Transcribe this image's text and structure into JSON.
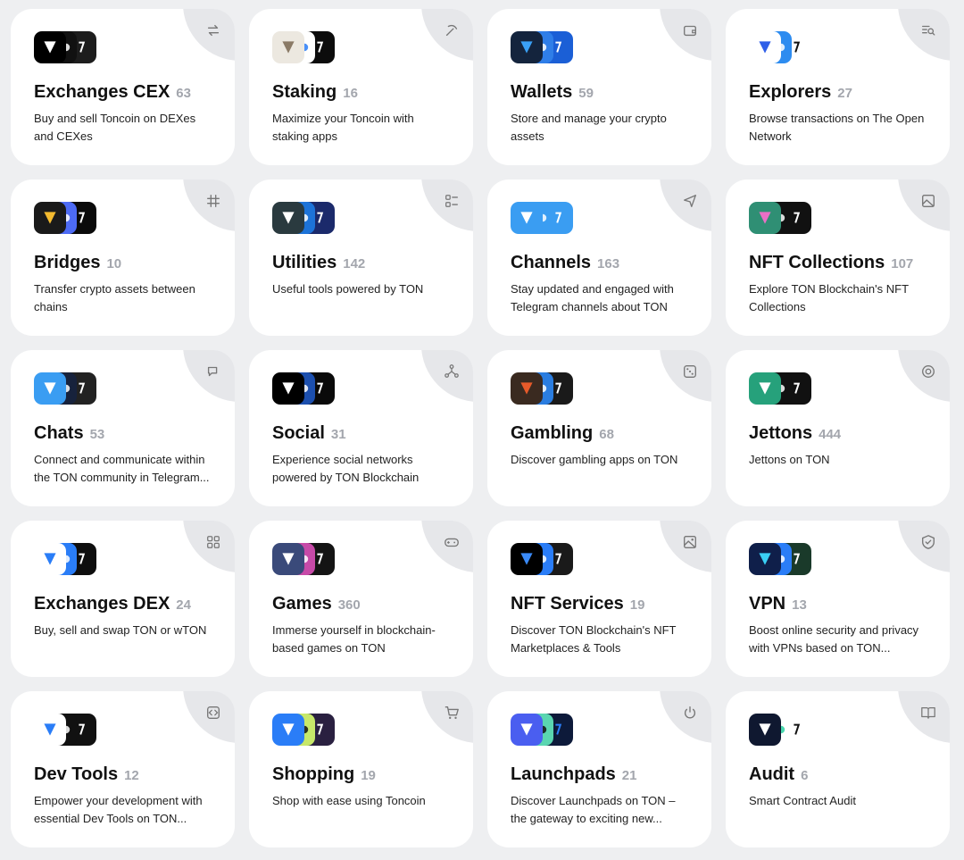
{
  "categories": [
    {
      "title": "Exchanges CEX",
      "count": "63",
      "description": "Buy and sell Toncoin on DEXes and CEXes",
      "icon": "exchange-arrows-icon",
      "app_icons": [
        {
          "bg": "#000000",
          "fg": "#ffffff"
        },
        {
          "bg": "#111111",
          "fg": "#ffffff"
        },
        {
          "bg": "#1d1d1d",
          "fg": "#ffffff"
        }
      ]
    },
    {
      "title": "Staking",
      "count": "16",
      "description": "Maximize your Toncoin with staking apps",
      "icon": "pickaxe-icon",
      "app_icons": [
        {
          "bg": "#ece8e0",
          "fg": "#8a7a66"
        },
        {
          "bg": "#ffffff",
          "fg": "#2a7df7"
        },
        {
          "bg": "#0c0c0c",
          "fg": "#ffffff"
        }
      ]
    },
    {
      "title": "Wallets",
      "count": "59",
      "description": "Store and manage your crypto assets",
      "icon": "wallet-icon",
      "app_icons": [
        {
          "bg": "#14243d",
          "fg": "#3aa0f6"
        },
        {
          "bg": "#2f7ee8",
          "fg": "#ffffff"
        },
        {
          "bg": "#1b5fd6",
          "fg": "#ffffff"
        }
      ]
    },
    {
      "title": "Explorers",
      "count": "27",
      "description": "Browse transactions on The Open Network",
      "icon": "search-list-icon",
      "app_icons": [
        {
          "bg": "#ffffff",
          "fg": "#2f5fe8"
        },
        {
          "bg": "#2d8cf0",
          "fg": "#ffffff"
        },
        {
          "bg": "#ffffff",
          "fg": "#111111"
        }
      ]
    },
    {
      "title": "Bridges",
      "count": "10",
      "description": "Transfer crypto assets between chains",
      "icon": "bridge-icon",
      "app_icons": [
        {
          "bg": "#1a1a1a",
          "fg": "#f3ba2f"
        },
        {
          "bg": "#4d6bf5",
          "fg": "#ffffff"
        },
        {
          "bg": "#0a0a0a",
          "fg": "#ffffff"
        }
      ]
    },
    {
      "title": "Utilities",
      "count": "142",
      "description": "Useful tools powered by TON",
      "icon": "list-icon",
      "app_icons": [
        {
          "bg": "#2a3a3f",
          "fg": "#ffffff"
        },
        {
          "bg": "#1d73d8",
          "fg": "#ffffff"
        },
        {
          "bg": "#1b2a6b",
          "fg": "#ffffff"
        }
      ]
    },
    {
      "title": "Channels",
      "count": "163",
      "description": "Stay updated and engaged with Telegram channels about TON",
      "icon": "paper-plane-icon",
      "app_icons": [
        {
          "bg": "#3a9df2",
          "fg": "#ffffff"
        },
        {
          "bg": "#3a9df2",
          "fg": "#ffffff"
        },
        {
          "bg": "#3a9df2",
          "fg": "#ffffff"
        }
      ]
    },
    {
      "title": "NFT Collections",
      "count": "107",
      "description": "Explore TON Blockchain's NFT Collections",
      "icon": "image-icon",
      "app_icons": [
        {
          "bg": "#2f8f74",
          "fg": "#e96fc6"
        },
        {
          "bg": "#111111",
          "fg": "#ffffff"
        },
        {
          "bg": "#111111",
          "fg": "#ffffff"
        }
      ]
    },
    {
      "title": "Chats",
      "count": "53",
      "description": "Connect and communicate within the TON community in Telegram...",
      "icon": "chat-bubbles-icon",
      "app_icons": [
        {
          "bg": "#3a9df2",
          "fg": "#ffffff"
        },
        {
          "bg": "#17223c",
          "fg": "#ffffff"
        },
        {
          "bg": "#222222",
          "fg": "#ffffff"
        }
      ]
    },
    {
      "title": "Social",
      "count": "31",
      "description": "Experience social networks powered by TON Blockchain",
      "icon": "network-icon",
      "app_icons": [
        {
          "bg": "#000000",
          "fg": "#ffffff"
        },
        {
          "bg": "#1c4fae",
          "fg": "#ffffff"
        },
        {
          "bg": "#0a0a0a",
          "fg": "#ffffff"
        }
      ]
    },
    {
      "title": "Gambling",
      "count": "68",
      "description": "Discover gambling apps on TON",
      "icon": "dice-icon",
      "app_icons": [
        {
          "bg": "#3a2a20",
          "fg": "#e65a2a"
        },
        {
          "bg": "#2a7de0",
          "fg": "#ffffff"
        },
        {
          "bg": "#1a1a1a",
          "fg": "#ffffff"
        }
      ]
    },
    {
      "title": "Jettons",
      "count": "444",
      "description": "Jettons on TON",
      "icon": "coin-icon",
      "app_icons": [
        {
          "bg": "#26a17b",
          "fg": "#ffffff"
        },
        {
          "bg": "#111111",
          "fg": "#ffffff"
        },
        {
          "bg": "#111111",
          "fg": "#ffffff"
        }
      ]
    },
    {
      "title": "Exchanges DEX",
      "count": "24",
      "description": "Buy, sell and swap TON or wTON",
      "icon": "grid-icon",
      "app_icons": [
        {
          "bg": "#ffffff",
          "fg": "#2a7df7"
        },
        {
          "bg": "#2a7df7",
          "fg": "#ffffff"
        },
        {
          "bg": "#0e0e0e",
          "fg": "#ffffff"
        }
      ]
    },
    {
      "title": "Games",
      "count": "360",
      "description": "Immerse yourself in blockchain-based games on TON",
      "icon": "gamepad-icon",
      "app_icons": [
        {
          "bg": "#3a4a7a",
          "fg": "#ffffff"
        },
        {
          "bg": "#c74aa8",
          "fg": "#ffffff"
        },
        {
          "bg": "#141414",
          "fg": "#ffffff"
        }
      ]
    },
    {
      "title": "NFT Services",
      "count": "19",
      "description": "Discover TON Blockchain's NFT Marketplaces & Tools",
      "icon": "picture-icon",
      "app_icons": [
        {
          "bg": "#000000",
          "fg": "#3a8af7"
        },
        {
          "bg": "#2a7df7",
          "fg": "#ffffff"
        },
        {
          "bg": "#1a1a1a",
          "fg": "#ffffff"
        }
      ]
    },
    {
      "title": "VPN",
      "count": "13",
      "description": "Boost online security and privacy with VPNs based on TON...",
      "icon": "shield-icon",
      "app_icons": [
        {
          "bg": "#0f1f4a",
          "fg": "#3ad0f6"
        },
        {
          "bg": "#2a7df7",
          "fg": "#ffffff"
        },
        {
          "bg": "#1a3a2a",
          "fg": "#ffffff"
        }
      ]
    },
    {
      "title": "Dev Tools",
      "count": "12",
      "description": "Empower your development with essential Dev Tools on TON...",
      "icon": "code-icon",
      "app_icons": [
        {
          "bg": "#ffffff",
          "fg": "#2a7df7"
        },
        {
          "bg": "#111111",
          "fg": "#ffffff"
        },
        {
          "bg": "#111111",
          "fg": "#ffffff"
        }
      ]
    },
    {
      "title": "Shopping",
      "count": "19",
      "description": "Shop with ease using Toncoin",
      "icon": "cart-icon",
      "app_icons": [
        {
          "bg": "#2a7df7",
          "fg": "#ffffff"
        },
        {
          "bg": "#c7e86a",
          "fg": "#111111"
        },
        {
          "bg": "#2a2040",
          "fg": "#ffffff"
        }
      ]
    },
    {
      "title": "Launchpads",
      "count": "21",
      "description": "Discover Launchpads on TON – the gateway to exciting new...",
      "icon": "power-icon",
      "app_icons": [
        {
          "bg": "#4a5ef0",
          "fg": "#ffffff"
        },
        {
          "bg": "#5ad6b0",
          "fg": "#111111"
        },
        {
          "bg": "#0d1a3a",
          "fg": "#2a7df7"
        }
      ]
    },
    {
      "title": "Audit",
      "count": "6",
      "description": "Smart Contract Audit",
      "icon": "book-icon",
      "app_icons": [
        {
          "bg": "#0f1830",
          "fg": "#ffffff"
        },
        {
          "bg": "#ffffff",
          "fg": "#2ad0a0"
        },
        {
          "bg": "#ffffff",
          "fg": "#111111"
        }
      ]
    }
  ]
}
